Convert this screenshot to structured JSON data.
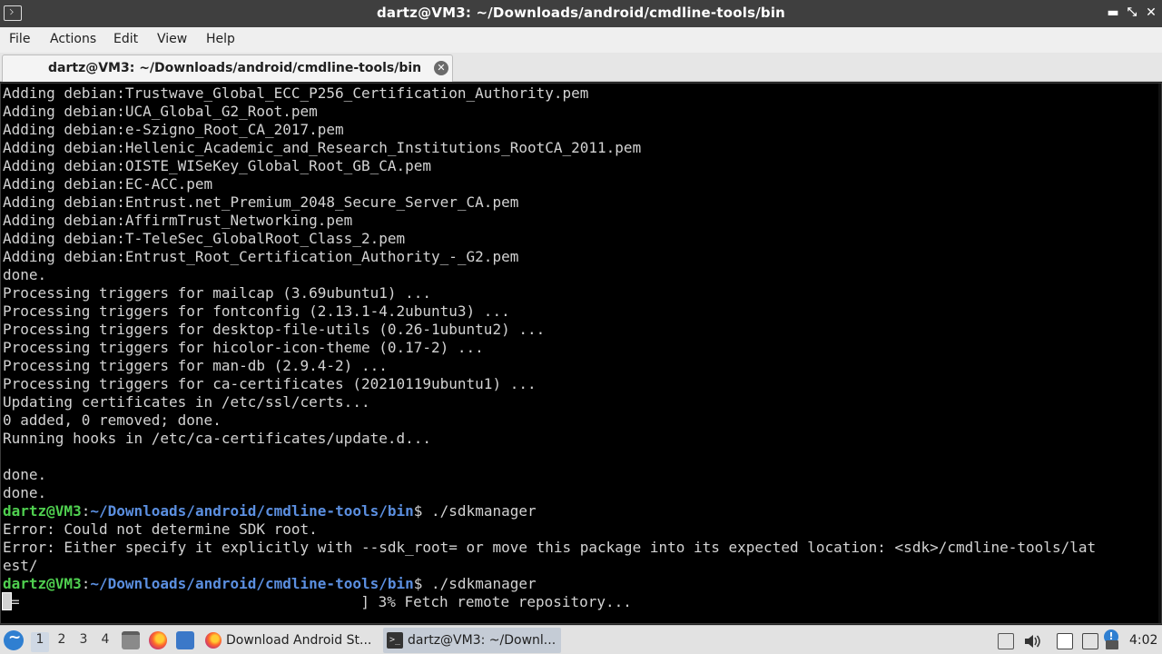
{
  "window": {
    "title": "dartz@VM3: ~/Downloads/android/cmdline-tools/bin",
    "controls": {
      "minimize": "▬",
      "maximize": "⤡",
      "close": "✕"
    }
  },
  "menu": {
    "items": [
      "File",
      "Actions",
      "Edit",
      "View",
      "Help"
    ]
  },
  "tabs": [
    {
      "label": "dartz@VM3: ~/Downloads/android/cmdline-tools/bin",
      "close_glyph": "✕"
    }
  ],
  "terminal": {
    "colors": {
      "background": "#000000",
      "text": "#d3d3d3",
      "prompt_user": "#4fcf4f",
      "prompt_path": "#5b8fe0"
    },
    "lines": [
      {
        "text": "Adding debian:Trustwave_Global_ECC_P256_Certification_Authority.pem"
      },
      {
        "text": "Adding debian:UCA_Global_G2_Root.pem"
      },
      {
        "text": "Adding debian:e-Szigno_Root_CA_2017.pem"
      },
      {
        "text": "Adding debian:Hellenic_Academic_and_Research_Institutions_RootCA_2011.pem"
      },
      {
        "text": "Adding debian:OISTE_WISeKey_Global_Root_GB_CA.pem"
      },
      {
        "text": "Adding debian:EC-ACC.pem"
      },
      {
        "text": "Adding debian:Entrust.net_Premium_2048_Secure_Server_CA.pem"
      },
      {
        "text": "Adding debian:AffirmTrust_Networking.pem"
      },
      {
        "text": "Adding debian:T-TeleSec_GlobalRoot_Class_2.pem"
      },
      {
        "text": "Adding debian:Entrust_Root_Certification_Authority_-_G2.pem"
      },
      {
        "text": "done."
      },
      {
        "text": "Processing triggers for mailcap (3.69ubuntu1) ..."
      },
      {
        "text": "Processing triggers for fontconfig (2.13.1-4.2ubuntu3) ..."
      },
      {
        "text": "Processing triggers for desktop-file-utils (0.26-1ubuntu2) ..."
      },
      {
        "text": "Processing triggers for hicolor-icon-theme (0.17-2) ..."
      },
      {
        "text": "Processing triggers for man-db (2.9.4-2) ..."
      },
      {
        "text": "Processing triggers for ca-certificates (20210119ubuntu1) ..."
      },
      {
        "text": "Updating certificates in /etc/ssl/certs..."
      },
      {
        "text": "0 added, 0 removed; done."
      },
      {
        "text": "Running hooks in /etc/ca-certificates/update.d..."
      },
      {
        "text": ""
      },
      {
        "text": "done."
      },
      {
        "text": "done."
      },
      {
        "prompt_user": "dartz@VM3",
        "prompt_sep": ":",
        "prompt_path": "~/Downloads/android/cmdline-tools/bin",
        "prompt_end": "$ ",
        "command": "./sdkmanager"
      },
      {
        "text": "Error: Could not determine SDK root."
      },
      {
        "text": "Error: Either specify it explicitly with --sdk_root= or move this package into its expected location: <sdk>/cmdline-tools/lat"
      },
      {
        "text": "est/"
      },
      {
        "prompt_user": "dartz@VM3",
        "prompt_sep": ":",
        "prompt_path": "~/Downloads/android/cmdline-tools/bin",
        "prompt_end": "$ ",
        "command": "./sdkmanager"
      },
      {
        "cursor": true,
        "text": "=                                       ] 3% Fetch remote repository..."
      }
    ]
  },
  "taskbar": {
    "workspaces": [
      "1",
      "2",
      "3",
      "4"
    ],
    "active_workspace": "1",
    "quicklaunch": [
      "file-manager-icon",
      "firefox-icon",
      "show-desktop-icon"
    ],
    "tasks": [
      {
        "label": "Download Android St...",
        "icon": "firefox-icon"
      },
      {
        "label": "dartz@VM3: ~/Downl...",
        "icon": "terminal-icon"
      }
    ],
    "tray": {
      "notification_glyph": "!",
      "clock": "4:02"
    }
  }
}
